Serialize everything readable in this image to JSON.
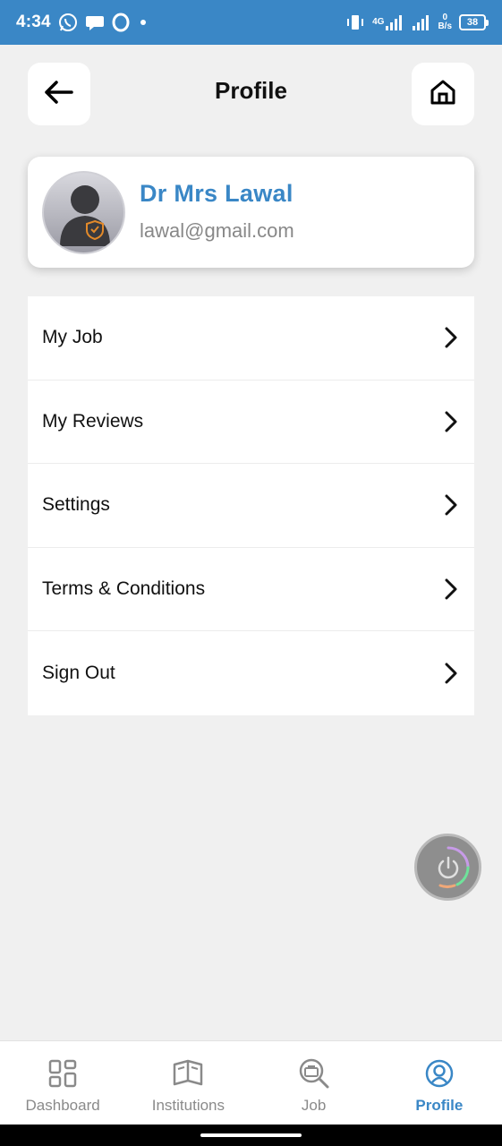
{
  "status_bar": {
    "time": "4:34",
    "network_label": "4G",
    "speed_value": "0",
    "speed_unit": "B/s",
    "battery_level": "38",
    "icons": [
      "whatsapp-icon",
      "chat-bubble-icon",
      "opera-icon",
      "dot-icon",
      "vibrate-icon",
      "signal-icon",
      "signal-icon",
      "battery-icon"
    ]
  },
  "header": {
    "title": "Profile",
    "back_icon": "arrow-left-icon",
    "home_icon": "home-icon"
  },
  "profile": {
    "name": "Dr Mrs Lawal",
    "email": "lawal@gmail.com",
    "avatar_icon": "user-shield-avatar-icon"
  },
  "menu": {
    "items": [
      {
        "label": "My Job"
      },
      {
        "label": "My Reviews"
      },
      {
        "label": "Settings"
      },
      {
        "label": "Terms & Conditions"
      },
      {
        "label": "Sign Out"
      }
    ],
    "chevron_icon": "chevron-right-icon"
  },
  "floating_button": {
    "icon": "power-icon"
  },
  "bottom_nav": {
    "items": [
      {
        "label": "Dashboard",
        "icon": "dashboard-grid-icon",
        "active": false
      },
      {
        "label": "Institutions",
        "icon": "book-icon",
        "active": false
      },
      {
        "label": "Job",
        "icon": "briefcase-search-icon",
        "active": false
      },
      {
        "label": "Profile",
        "icon": "profile-icon",
        "active": true
      }
    ]
  },
  "colors": {
    "accent": "#3a87c6",
    "background": "#f0f0f0",
    "inactive": "#8a8a8a"
  }
}
